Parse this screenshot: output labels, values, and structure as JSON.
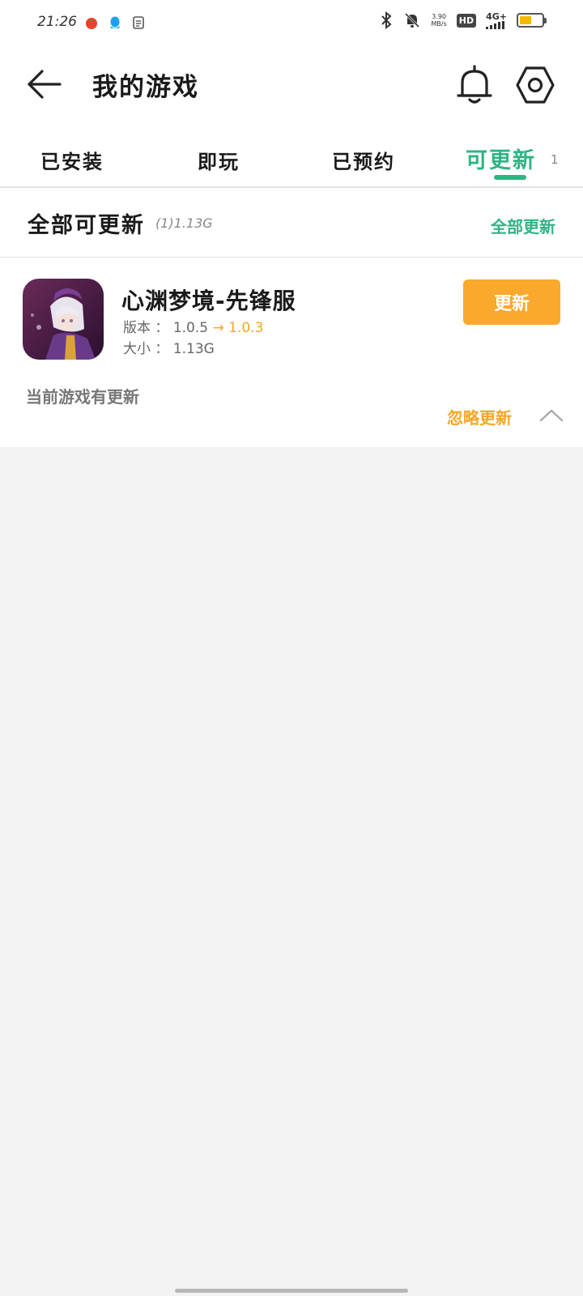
{
  "status_bar": {
    "time": "21:26",
    "net_speed_value": "3.90",
    "net_speed_unit": "MB/s",
    "hd_label": "HD",
    "network_type": "4G+",
    "battery_level_pct": 55,
    "icons": [
      "tomato-app-icon",
      "qq-icon",
      "document-icon",
      "bluetooth-icon",
      "mute-icon",
      "signal-icon",
      "battery-icon"
    ]
  },
  "header": {
    "title": "我的游戏",
    "icons": [
      "back-arrow-icon",
      "bell-icon",
      "settings-icon"
    ]
  },
  "tabs": {
    "items": [
      {
        "label": "已安装"
      },
      {
        "label": "即玩"
      },
      {
        "label": "已预约"
      },
      {
        "label": "可更新"
      }
    ],
    "active_index": 3,
    "updatable_count": "1"
  },
  "section": {
    "title": "全部可更新",
    "meta": "(1)1.13G",
    "update_all_label": "全部更新"
  },
  "game": {
    "name": "心渊梦境-先锋服",
    "version_label": "版本",
    "current_version": "1.0.5",
    "arrow": "→",
    "new_version": "1.0.3",
    "size_label": "大小",
    "size": "1.13G",
    "update_button_label": "更新",
    "note": "当前游戏有更新",
    "ignore_label": "忽略更新"
  },
  "colors": {
    "accent_green": "#2fb482",
    "accent_orange": "#fba92c",
    "background": "#f3f3f3"
  }
}
